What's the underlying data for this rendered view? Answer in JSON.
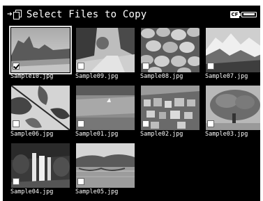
{
  "header": {
    "title": "Select Files to Copy",
    "card_label": "CF"
  },
  "files": [
    {
      "name": "Sample10.jpg",
      "checked": true
    },
    {
      "name": "Sample09.jpg",
      "checked": false
    },
    {
      "name": "Sample08.jpg",
      "checked": false
    },
    {
      "name": "Sample07.jpg",
      "checked": false
    },
    {
      "name": "Sample06.jpg",
      "checked": false
    },
    {
      "name": "Sample01.jpg",
      "checked": false
    },
    {
      "name": "Sample02.jpg",
      "checked": false
    },
    {
      "name": "Sample03.jpg",
      "checked": false
    },
    {
      "name": "Sample04.jpg",
      "checked": false
    },
    {
      "name": "Sample05.jpg",
      "checked": false
    }
  ],
  "colors": {
    "background": "#000000",
    "text": "#ffffff"
  }
}
